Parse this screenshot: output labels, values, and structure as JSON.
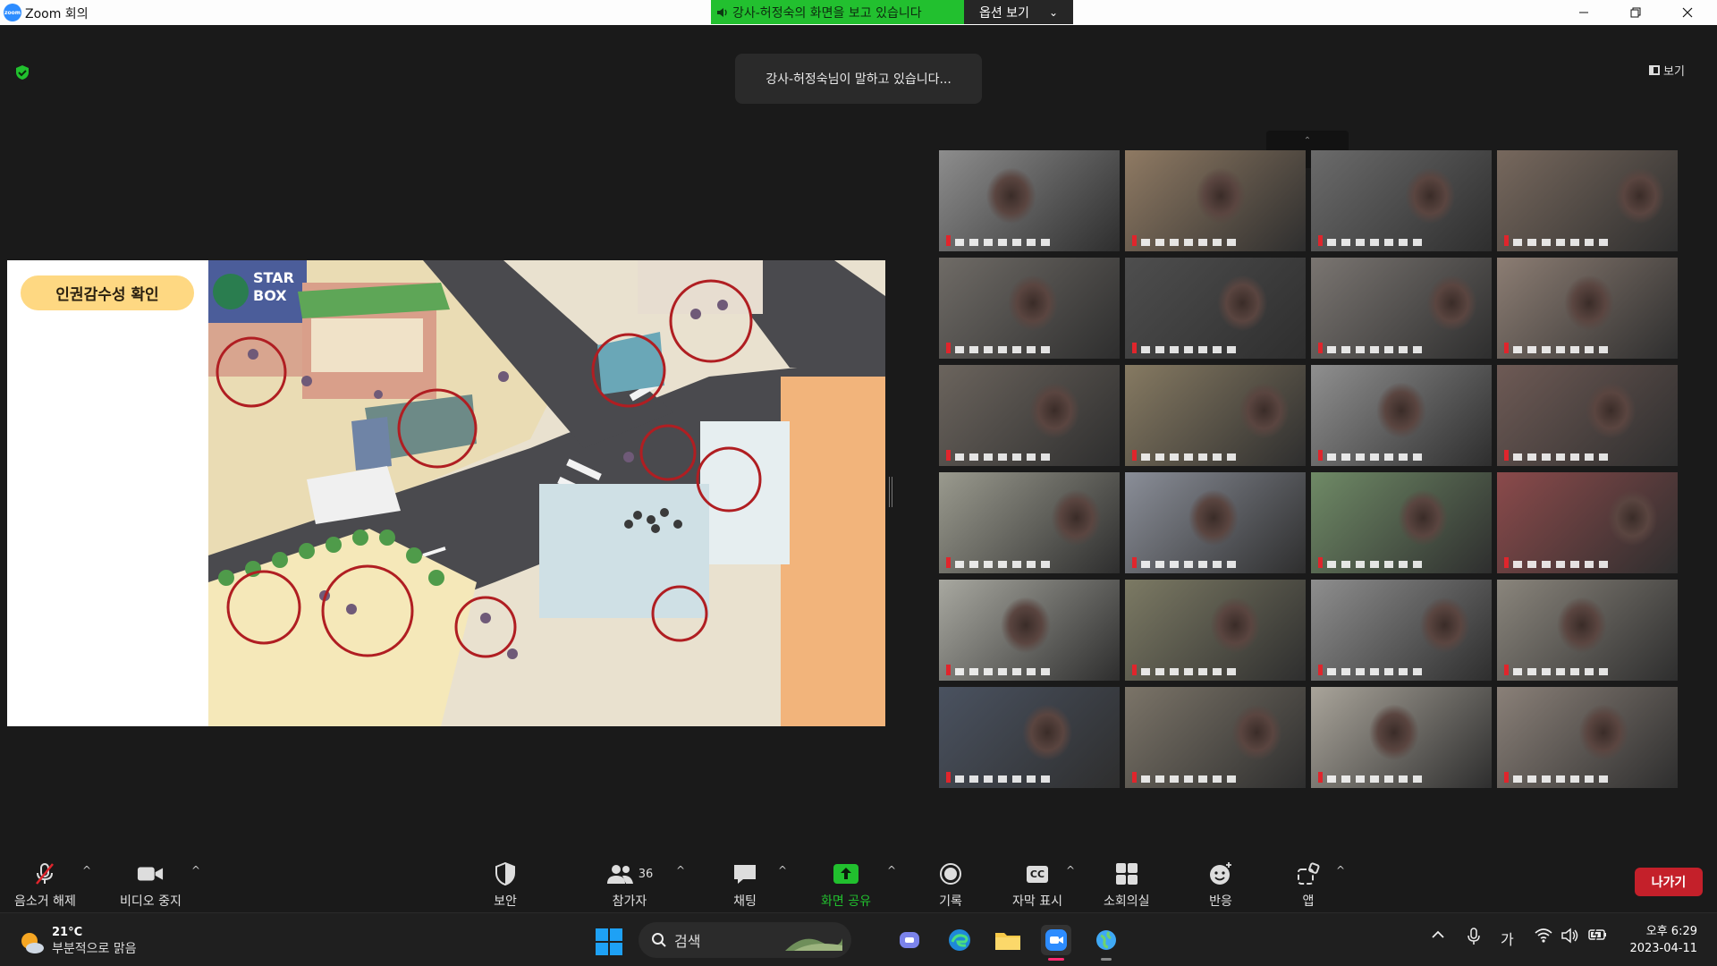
{
  "window": {
    "title": "Zoom 회의",
    "app_icon_text": "zoom",
    "share_banner": "강사-허정숙의 화면을 보고 있습니다",
    "options_label": "옵션 보기"
  },
  "meeting": {
    "speaking_notice": "강사-허정숙님이 말하고 있습니다...",
    "view_label": "보기",
    "collapse_label": "⌃"
  },
  "shared_screen": {
    "slide_badge": "인권감수성 확인",
    "sign_text_line1": "STAR",
    "sign_text_line2": "BOX"
  },
  "gallery": {
    "tile_count": 24,
    "colors": [
      "#8d8d8d",
      "#8f7a63",
      "#6b6b6b",
      "#77685d",
      "#6f6b66",
      "#4e4e4e",
      "#7a7571",
      "#8c7d73",
      "#6b645d",
      "#867a62",
      "#8f8f8f",
      "#6e5a55",
      "#9a9a8e",
      "#8a8e98",
      "#6f8a66",
      "#8b4a4b",
      "#a8a8a0",
      "#7c7a64",
      "#8e8e8e",
      "#8a857c",
      "#4a5260",
      "#7b7468",
      "#a9a49a",
      "#8a8078"
    ]
  },
  "toolbar": {
    "mute": "음소거 해제",
    "video": "비디오 중지",
    "security": "보안",
    "participants": "참가자",
    "participants_count": "36",
    "chat": "채팅",
    "share": "화면 공유",
    "record": "기록",
    "captions": "자막 표시",
    "captions_icon": "CC",
    "breakout": "소회의실",
    "reactions": "반응",
    "apps": "앱",
    "leave": "나가기"
  },
  "taskbar": {
    "temperature": "21°C",
    "weather": "부분적으로 맑음",
    "search": "검색",
    "ime": "가",
    "time": "오후 6:29",
    "date": "2023-04-11"
  },
  "colors": {
    "share_green": "#22c02f",
    "leave_red": "#c4202a",
    "accent_blue": "#2d8cff"
  }
}
